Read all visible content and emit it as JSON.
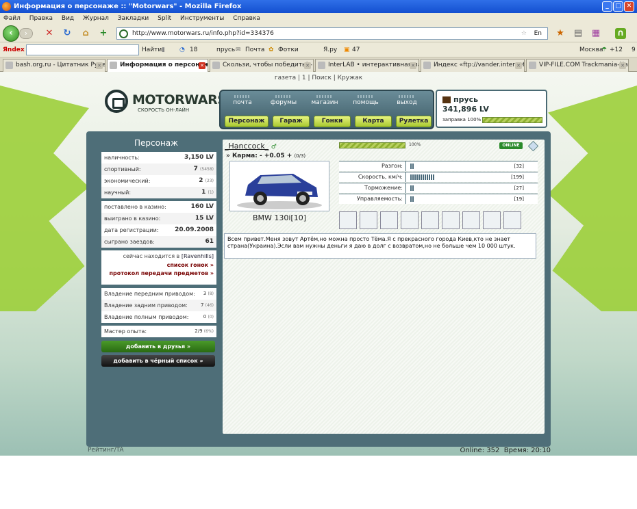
{
  "window": {
    "title": "Информация о персонаже :: \"Motorwars\" - Mozilla Firefox"
  },
  "menu": [
    "Файл",
    "Правка",
    "Вид",
    "Журнал",
    "Закладки",
    "Split",
    "Инструменты",
    "Справка"
  ],
  "address": {
    "url": "http://www.motorwars.ru/info.php?id=334376",
    "lang": "En"
  },
  "yandex": {
    "logo": "Яndex",
    "find": "Найти",
    "count18": "18",
    "user": "прусь",
    "mail": "Почта",
    "photos": "Фотки",
    "yaru": "Я.ру",
    "count47": "47",
    "city": "Москва",
    "temp": "+12",
    "num9": "9"
  },
  "tabs": [
    {
      "label": "bash.org.ru - Цитатник Рунета"
    },
    {
      "label": "Информация о персонаж..."
    },
    {
      "label": "Скользи, чтобы победить! -..."
    },
    {
      "label": "InterLAB • интерактивная ла..."
    },
    {
      "label": "Индекс «ftp://vander.internet..."
    },
    {
      "label": "VIP-FILE.COM Trackmania-Nati..."
    }
  ],
  "toplinks": "газета | 1 | Поиск | Кружак",
  "logo": {
    "name": "MOTORWARS.RU",
    "sub": "СКОРОСТЬ ОН-ЛАЙН"
  },
  "topnav": [
    "почта",
    "форумы",
    "магазин",
    "помощь",
    "выход"
  ],
  "gnav": [
    "Персонаж",
    "Гараж",
    "Гонки",
    "Карта",
    "Рулетка"
  ],
  "account": {
    "name": "прусь",
    "money": "341,896 LV",
    "fuel": "заправка 100%"
  },
  "sidebar": {
    "title": "Персонаж",
    "rows": [
      {
        "label": "наличность:",
        "value": "3,150 LV",
        "extra": ""
      },
      {
        "label": "спортивный:",
        "value": "7",
        "extra": "(5458)"
      },
      {
        "label": "экономический:",
        "value": "2",
        "extra": "(23)"
      },
      {
        "label": "научный:",
        "value": "1",
        "extra": "(1)"
      },
      {
        "label": "поставлено в казино:",
        "value": "160 LV",
        "extra": ""
      },
      {
        "label": "выиграно в казино:",
        "value": "15 LV",
        "extra": ""
      },
      {
        "label": "дата регистрации:",
        "value": "20.09.2008",
        "extra": ""
      },
      {
        "label": "сыграно заездов:",
        "value": "61",
        "extra": ""
      }
    ],
    "location_prefix": "сейчас находится в",
    "location": "[Ravenhills]",
    "race_list": "список гонок »",
    "transfer_log": "протокол передачи предметов »",
    "drive": [
      {
        "label": "Владение передним приводом:",
        "value": "3",
        "extra": "(8)"
      },
      {
        "label": "Владение задним приводом:",
        "value": "7",
        "extra": "(46)"
      },
      {
        "label": "Владение полным приводом:",
        "value": "0",
        "extra": "(0)"
      }
    ],
    "master": {
      "label": "Мастер опыта:",
      "value": "2/9",
      "extra": "(6%)"
    },
    "add_friend": "добавить в друзья »",
    "add_black": "добавить в чёрный список »"
  },
  "character": {
    "name": "_Hanccock_",
    "karma_label": "» Карма:",
    "karma_value": "- +0.05 +",
    "karma_extra": "(0/3)",
    "hp": "100%",
    "hp_fraction": 1.0,
    "online": "ONLINE",
    "car": "BMW 130i[10]",
    "about": "Всем привет.Меня зовут Артём,но можна просто Тёма.Я с прекрасного города Киев,кто не знает страна(Украина).Эсли вам нужны деньги я даю в долг с возвратом,но не больше чем 10 000 штук."
  },
  "stats": [
    {
      "label": "Разгон:",
      "value": "[32]",
      "level": 32
    },
    {
      "label": "Скорость, км/ч:",
      "value": "[199]",
      "level": 199
    },
    {
      "label": "Торможение:",
      "value": "[27]",
      "level": 27
    },
    {
      "label": "Управляемость:",
      "value": "[19]",
      "level": 19
    }
  ],
  "parts_icons": [
    "shock-absorber-icon",
    "tire-icon",
    "exhaust-icon",
    "turbo-icon",
    "brake-disc-icon",
    "bearings-icon",
    "gear-icon",
    "battery-icon",
    "chip-icon"
  ],
  "status": {
    "left": "Рейтинг/TA",
    "online": "Online: 352",
    "time": "Время: 20:10"
  },
  "colors": {
    "accent_green": "#9ccf3a",
    "frame": "#4e6e78",
    "title_blue": "#1450d0"
  }
}
